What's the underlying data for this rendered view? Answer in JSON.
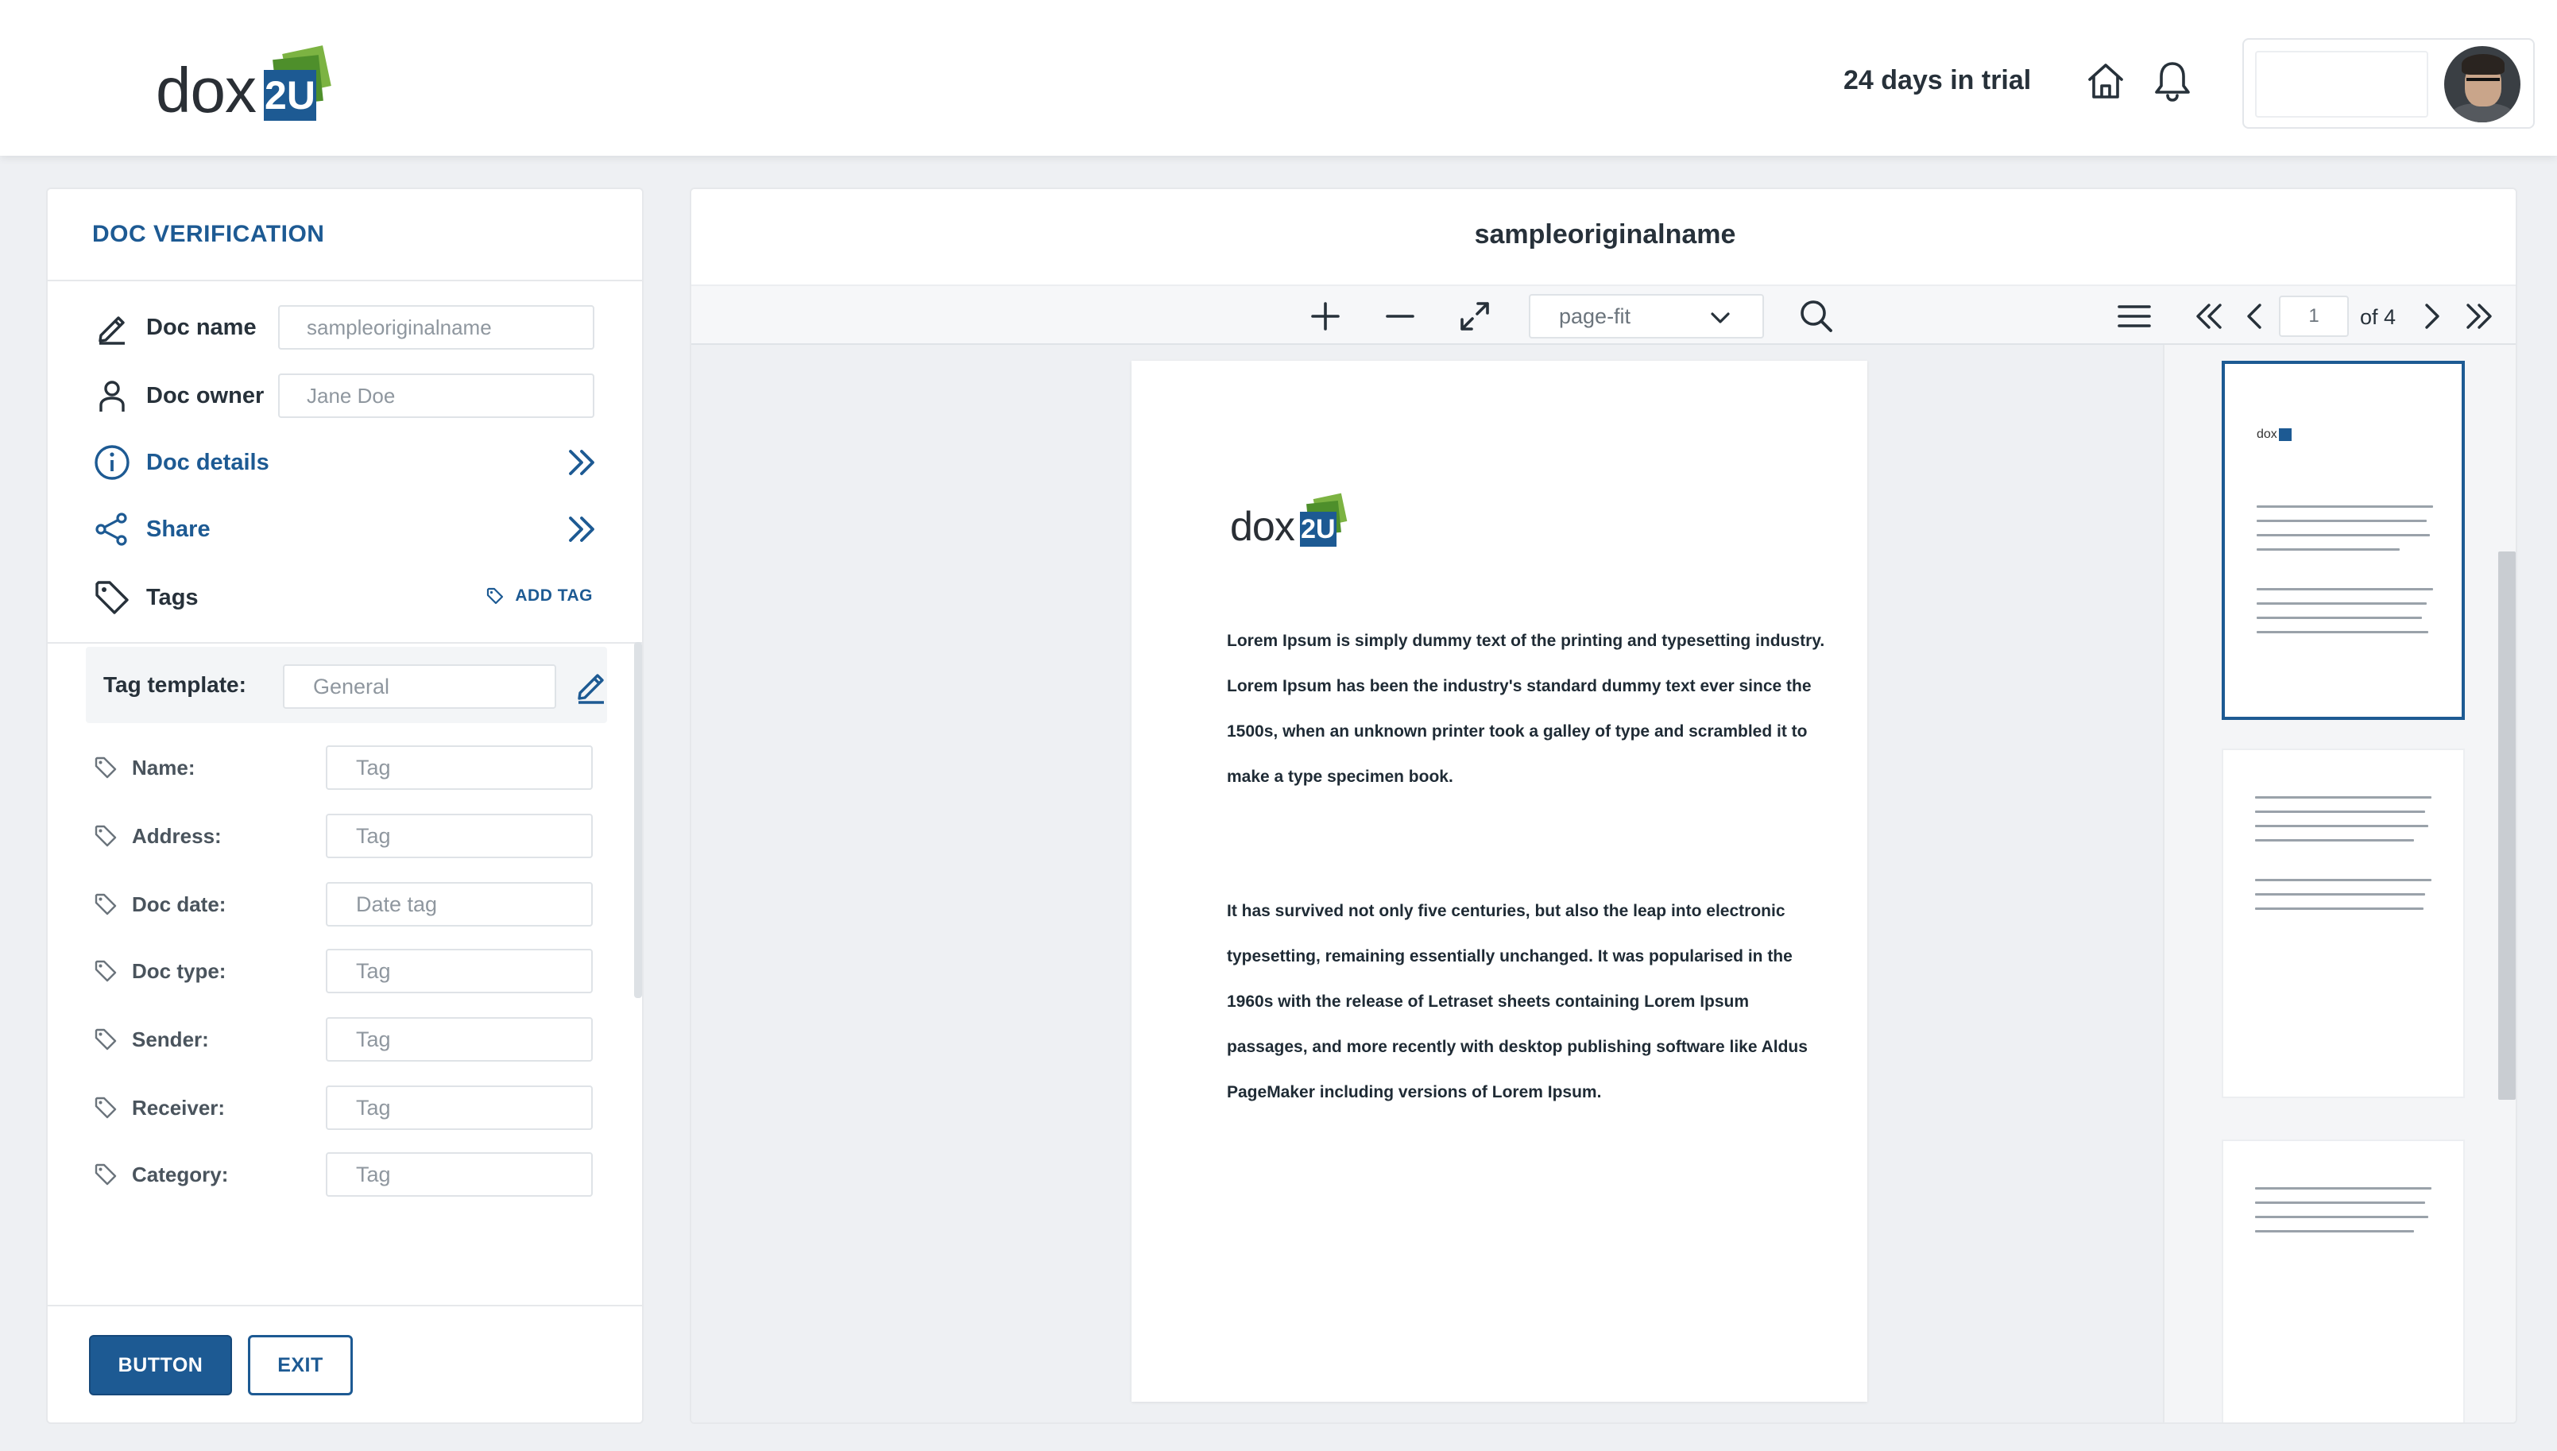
{
  "app": {
    "logo_text": "dox",
    "logo_badge": "2U",
    "trial_text": "24 days in trial"
  },
  "icons": {
    "home": "home-icon",
    "bell": "bell-icon",
    "avatar": "user-avatar"
  },
  "colors": {
    "brand": "#1d5a93",
    "brand_green": "#7cb342",
    "background": "#eef0f3"
  },
  "left_panel": {
    "title": "DOC VERIFICATION",
    "doc_name_label": "Doc name",
    "doc_name_value": "sampleoriginalname",
    "doc_owner_label": "Doc owner",
    "doc_owner_value": "Jane Doe",
    "doc_details_label": "Doc details",
    "share_label": "Share",
    "tags_label": "Tags",
    "add_tag_label": "ADD TAG",
    "tag_template_label": "Tag template:",
    "tag_template_value": "General",
    "tag_fields": [
      {
        "label": "Name:",
        "value": "Tag"
      },
      {
        "label": "Address:",
        "value": "Tag"
      },
      {
        "label": "Doc date:",
        "value": "Date tag"
      },
      {
        "label": "Doc type:",
        "value": "Tag"
      },
      {
        "label": "Sender:",
        "value": "Tag"
      },
      {
        "label": "Receiver:",
        "value": "Tag"
      },
      {
        "label": "Category:",
        "value": "Tag"
      }
    ],
    "primary_button": "BUTTON",
    "exit_button": "EXIT"
  },
  "viewer": {
    "doc_title": "sampleoriginalname",
    "zoom_value": "page-fit",
    "current_page": "1",
    "page_total_text": "of 4",
    "paragraph_1": "Lorem Ipsum is simply dummy text of the printing and typesetting industry. Lorem Ipsum has been the industry's standard dummy text ever since the 1500s, when an unknown printer took a galley of type and scrambled it to make a type specimen book.",
    "paragraph_2": "It has survived not only five centuries, but also the leap into electronic typesetting, remaining essentially unchanged. It was popularised in the 1960s with the release of Letraset sheets containing Lorem Ipsum passages, and more recently with desktop publishing software like Aldus PageMaker including versions of Lorem Ipsum."
  }
}
